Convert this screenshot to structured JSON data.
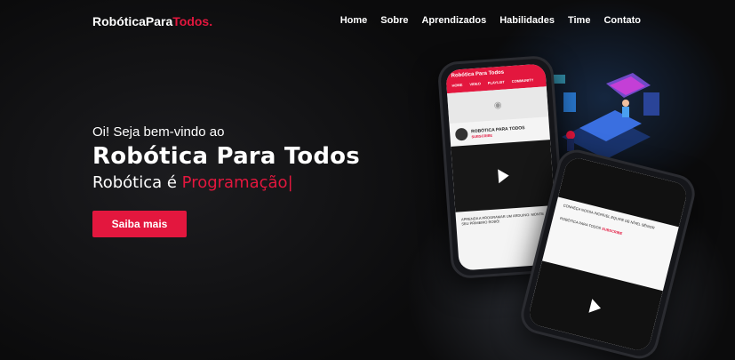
{
  "brand": {
    "name_main": "RobóticaPara",
    "name_accent": "Todos."
  },
  "nav": [
    "Home",
    "Sobre",
    "Aprendizados",
    "Habilidades",
    "Time",
    "Contato"
  ],
  "hero": {
    "greeting": "Oi! Seja bem-vindo ao",
    "title": "Robótica Para Todos",
    "subtitle_prefix": "Robótica é ",
    "subtitle_typed": "Programação",
    "cursor": "|",
    "cta": "Saiba mais"
  },
  "phone1": {
    "app_title": "Robótica Para Todos",
    "tabs": [
      "HOME",
      "VIDEO",
      "PLAYLIST",
      "COMMUNITY"
    ],
    "channel_name": "ROBÓTICA PARA TODOS",
    "subscribe": "SUBSCRIBE",
    "video_item": "APRENDA A PROGRAMAR UM ARDUINO: MONTE SEU PRIMEIRO ROBÔ!"
  },
  "phone2": {
    "headline": "CONHEÇA NOSSA INCRÍVEL EQUIPE DE NÍVEL SÊNIOR",
    "channel_name": "ROBÓTICA PARA TODOS",
    "subscribe": "SUBSCRIBE"
  },
  "icons": [
    "camera-icon",
    "play-icon",
    "search-icon"
  ],
  "colors": {
    "accent": "#e3173e",
    "background": "#0d0d0f"
  }
}
